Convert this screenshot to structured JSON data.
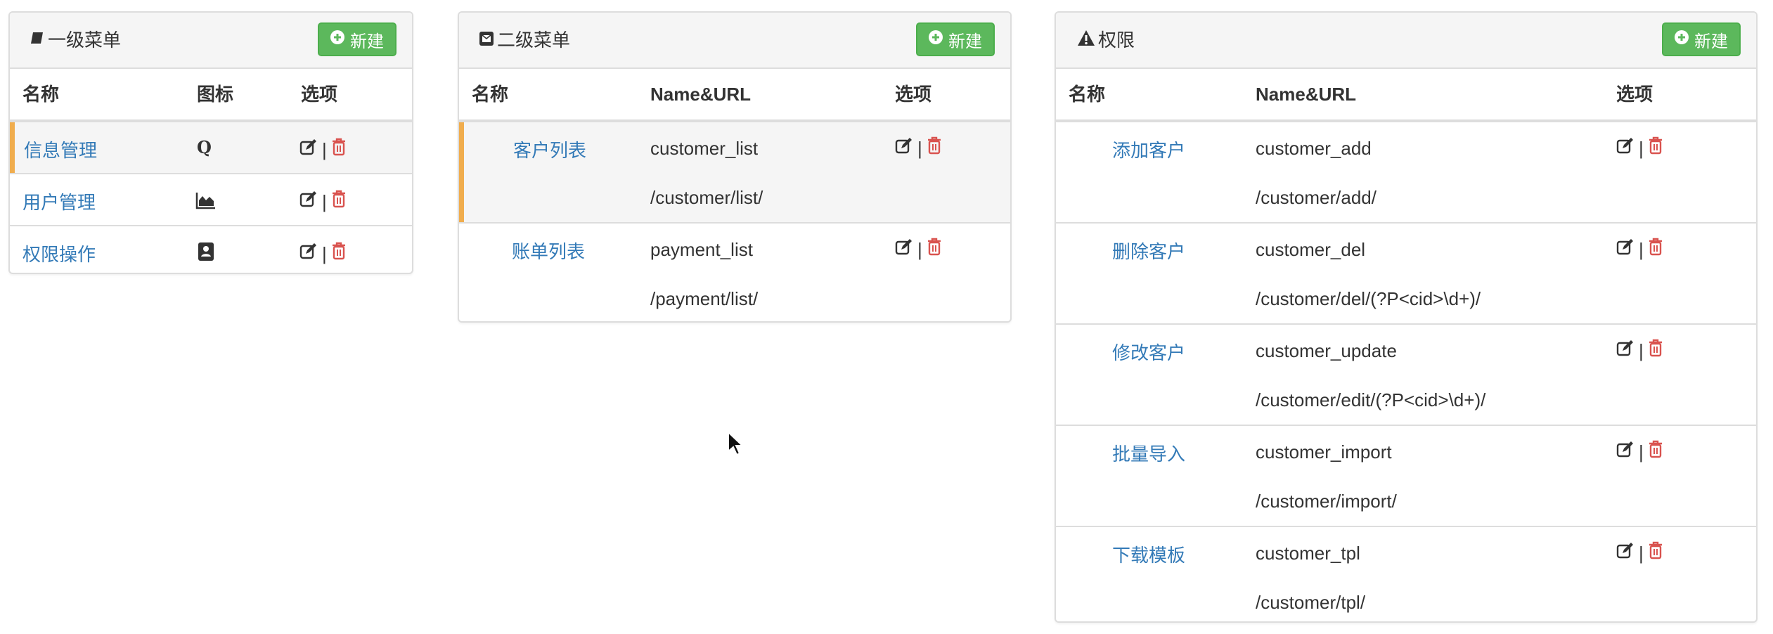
{
  "colors": {
    "link": "#337ab7",
    "success": "#5cb85c",
    "danger": "#d9534f",
    "active_marker": "#f0ad4e",
    "active_row": "#f5f5f5"
  },
  "panel1": {
    "title": "一级菜单",
    "title_icon": "book-icon",
    "new_label": "新建",
    "headers": {
      "name": "名称",
      "icon": "图标",
      "options": "选项"
    },
    "rows": [
      {
        "name": "信息管理",
        "icon": "q-letter-icon",
        "active": true
      },
      {
        "name": "用户管理",
        "icon": "area-chart-icon",
        "active": false
      },
      {
        "name": "权限操作",
        "icon": "address-book-icon",
        "active": false
      }
    ],
    "separator": "|"
  },
  "panel2": {
    "title": "二级菜单",
    "title_icon": "envelope-square-icon",
    "new_label": "新建",
    "headers": {
      "name": "名称",
      "nameurl": "Name&URL",
      "options": "选项"
    },
    "rows": [
      {
        "name": "客户列表",
        "code": "customer_list",
        "url": "/customer/list/",
        "active": true
      },
      {
        "name": "账单列表",
        "code": "payment_list",
        "url": "/payment/list/",
        "active": false
      }
    ],
    "separator": "|"
  },
  "panel3": {
    "title": "权限",
    "title_icon": "warning-icon",
    "new_label": "新建",
    "headers": {
      "name": "名称",
      "nameurl": "Name&URL",
      "options": "选项"
    },
    "rows": [
      {
        "name": "添加客户",
        "code": "customer_add",
        "url": "/customer/add/"
      },
      {
        "name": "删除客户",
        "code": "customer_del",
        "url": "/customer/del/(?P<cid>\\d+)/"
      },
      {
        "name": "修改客户",
        "code": "customer_update",
        "url": "/customer/edit/(?P<cid>\\d+)/"
      },
      {
        "name": "批量导入",
        "code": "customer_import",
        "url": "/customer/import/"
      },
      {
        "name": "下载模板",
        "code": "customer_tpl",
        "url": "/customer/tpl/"
      }
    ],
    "separator": "|"
  }
}
